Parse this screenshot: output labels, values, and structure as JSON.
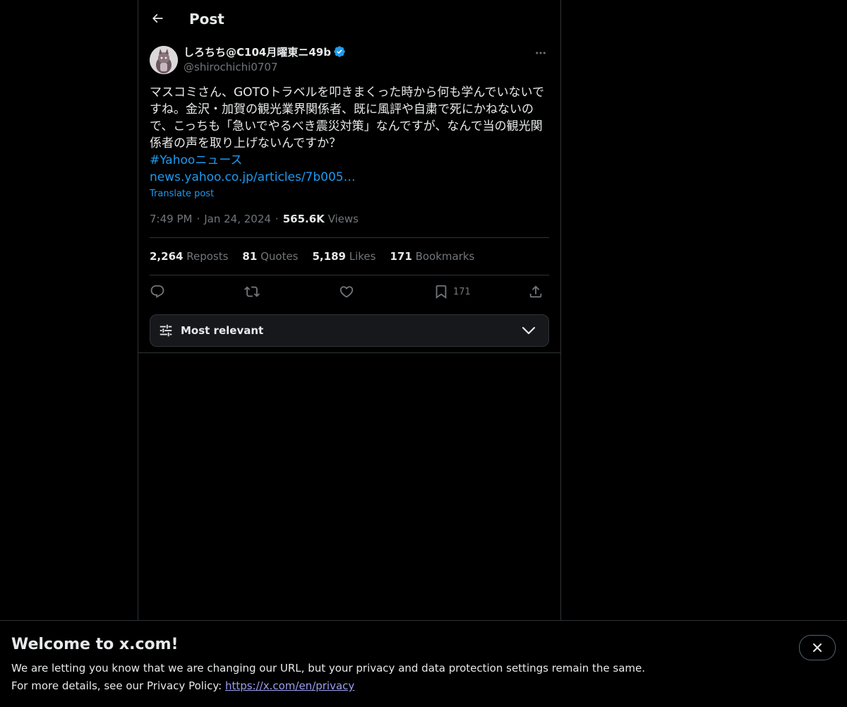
{
  "header": {
    "title": "Post"
  },
  "post": {
    "author_name": "しろちち@C104月曜東ニ49b",
    "author_handle": "@shirochichi0707",
    "text": "マスコミさん、GOTOトラベルを叩きまくった時から何も学んでいないですね。金沢・加賀の観光業界関係者、既に風評や自粛で死にかねないので、こっちも「急いでやるべき震災対策」なんですが、なんで当の観光関係者の声を取り上げないんですか？",
    "hashtag": "#Yahooニュース",
    "link": "news.yahoo.co.jp/articles/7b005…",
    "translate_label": "Translate post",
    "time": "7:49 PM",
    "date": "Jan 24, 2024",
    "views_count": "565.6K",
    "views_label": "Views"
  },
  "stats": {
    "reposts_count": "2,264",
    "reposts_label": "Reposts",
    "quotes_count": "81",
    "quotes_label": "Quotes",
    "likes_count": "5,189",
    "likes_label": "Likes",
    "bookmarks_count": "171",
    "bookmarks_label": "Bookmarks"
  },
  "actions": {
    "reply_icon": "reply-icon",
    "repost_icon": "repost-icon",
    "like_icon": "heart-icon",
    "bookmark_icon": "bookmark-icon",
    "bookmark_count": "171",
    "share_icon": "share-icon"
  },
  "sort": {
    "label": "Most relevant"
  },
  "banner": {
    "title": "Welcome to x.com!",
    "line1": "We are letting you know that we are changing our URL, but your privacy and data protection settings remain the same.",
    "line2_prefix": "For more details, see our Privacy Policy: ",
    "link": "https://x.com/en/privacy"
  },
  "colors": {
    "background": "#000000",
    "text": "#e7e9ea",
    "secondary": "#71767b",
    "accent": "#1d9bf0",
    "border": "#2f3336"
  }
}
